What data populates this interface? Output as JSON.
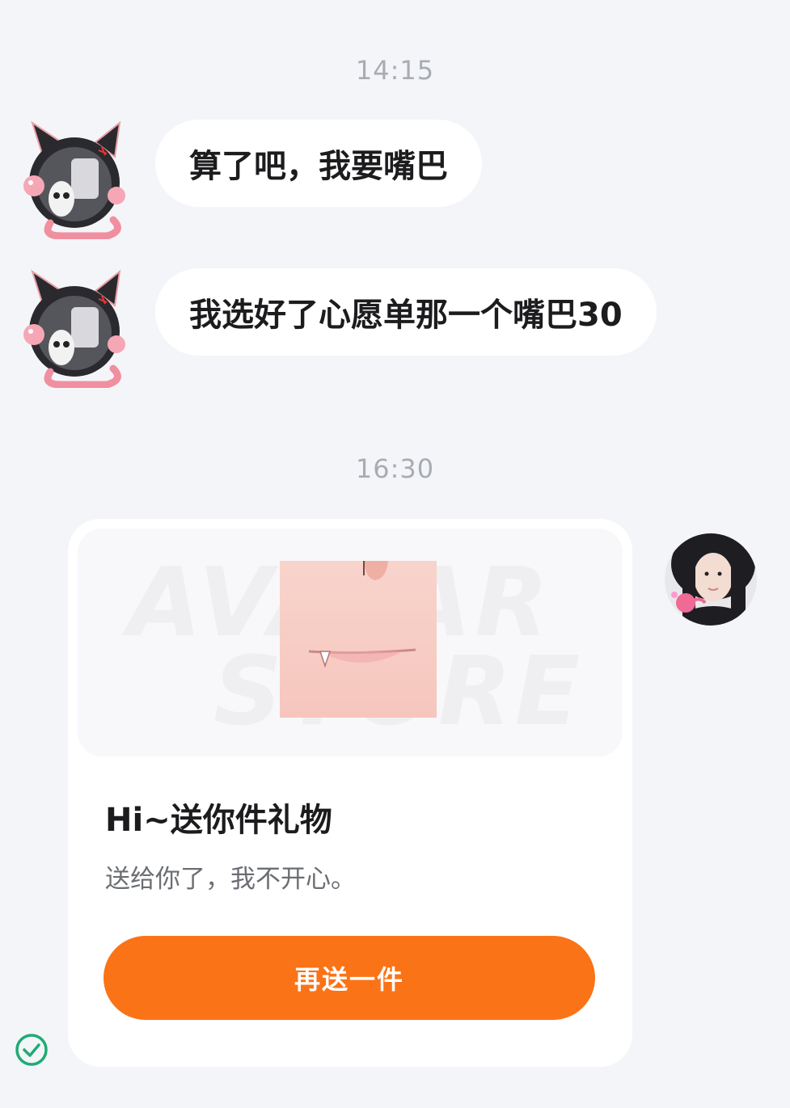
{
  "messages": [
    {
      "time": "14:15"
    },
    {
      "sender": "other",
      "text": "算了吧，我要嘴巴"
    },
    {
      "sender": "other",
      "text": "我选好了心愿单那一个嘴巴30"
    },
    {
      "time": "16:30"
    }
  ],
  "gift_card": {
    "watermark_top": "AVATAR",
    "watermark_bottom": "STORE",
    "title": "Hi~送你件礼物",
    "description": "送给你了，我不开心。",
    "button_label": "再送一件"
  },
  "colors": {
    "background": "#f4f5f8",
    "bubble": "#ffffff",
    "accent": "#fb7317",
    "check": "#1fab75",
    "timestamp": "#a8acb2"
  },
  "icons": {
    "status": "check-circle-icon"
  }
}
